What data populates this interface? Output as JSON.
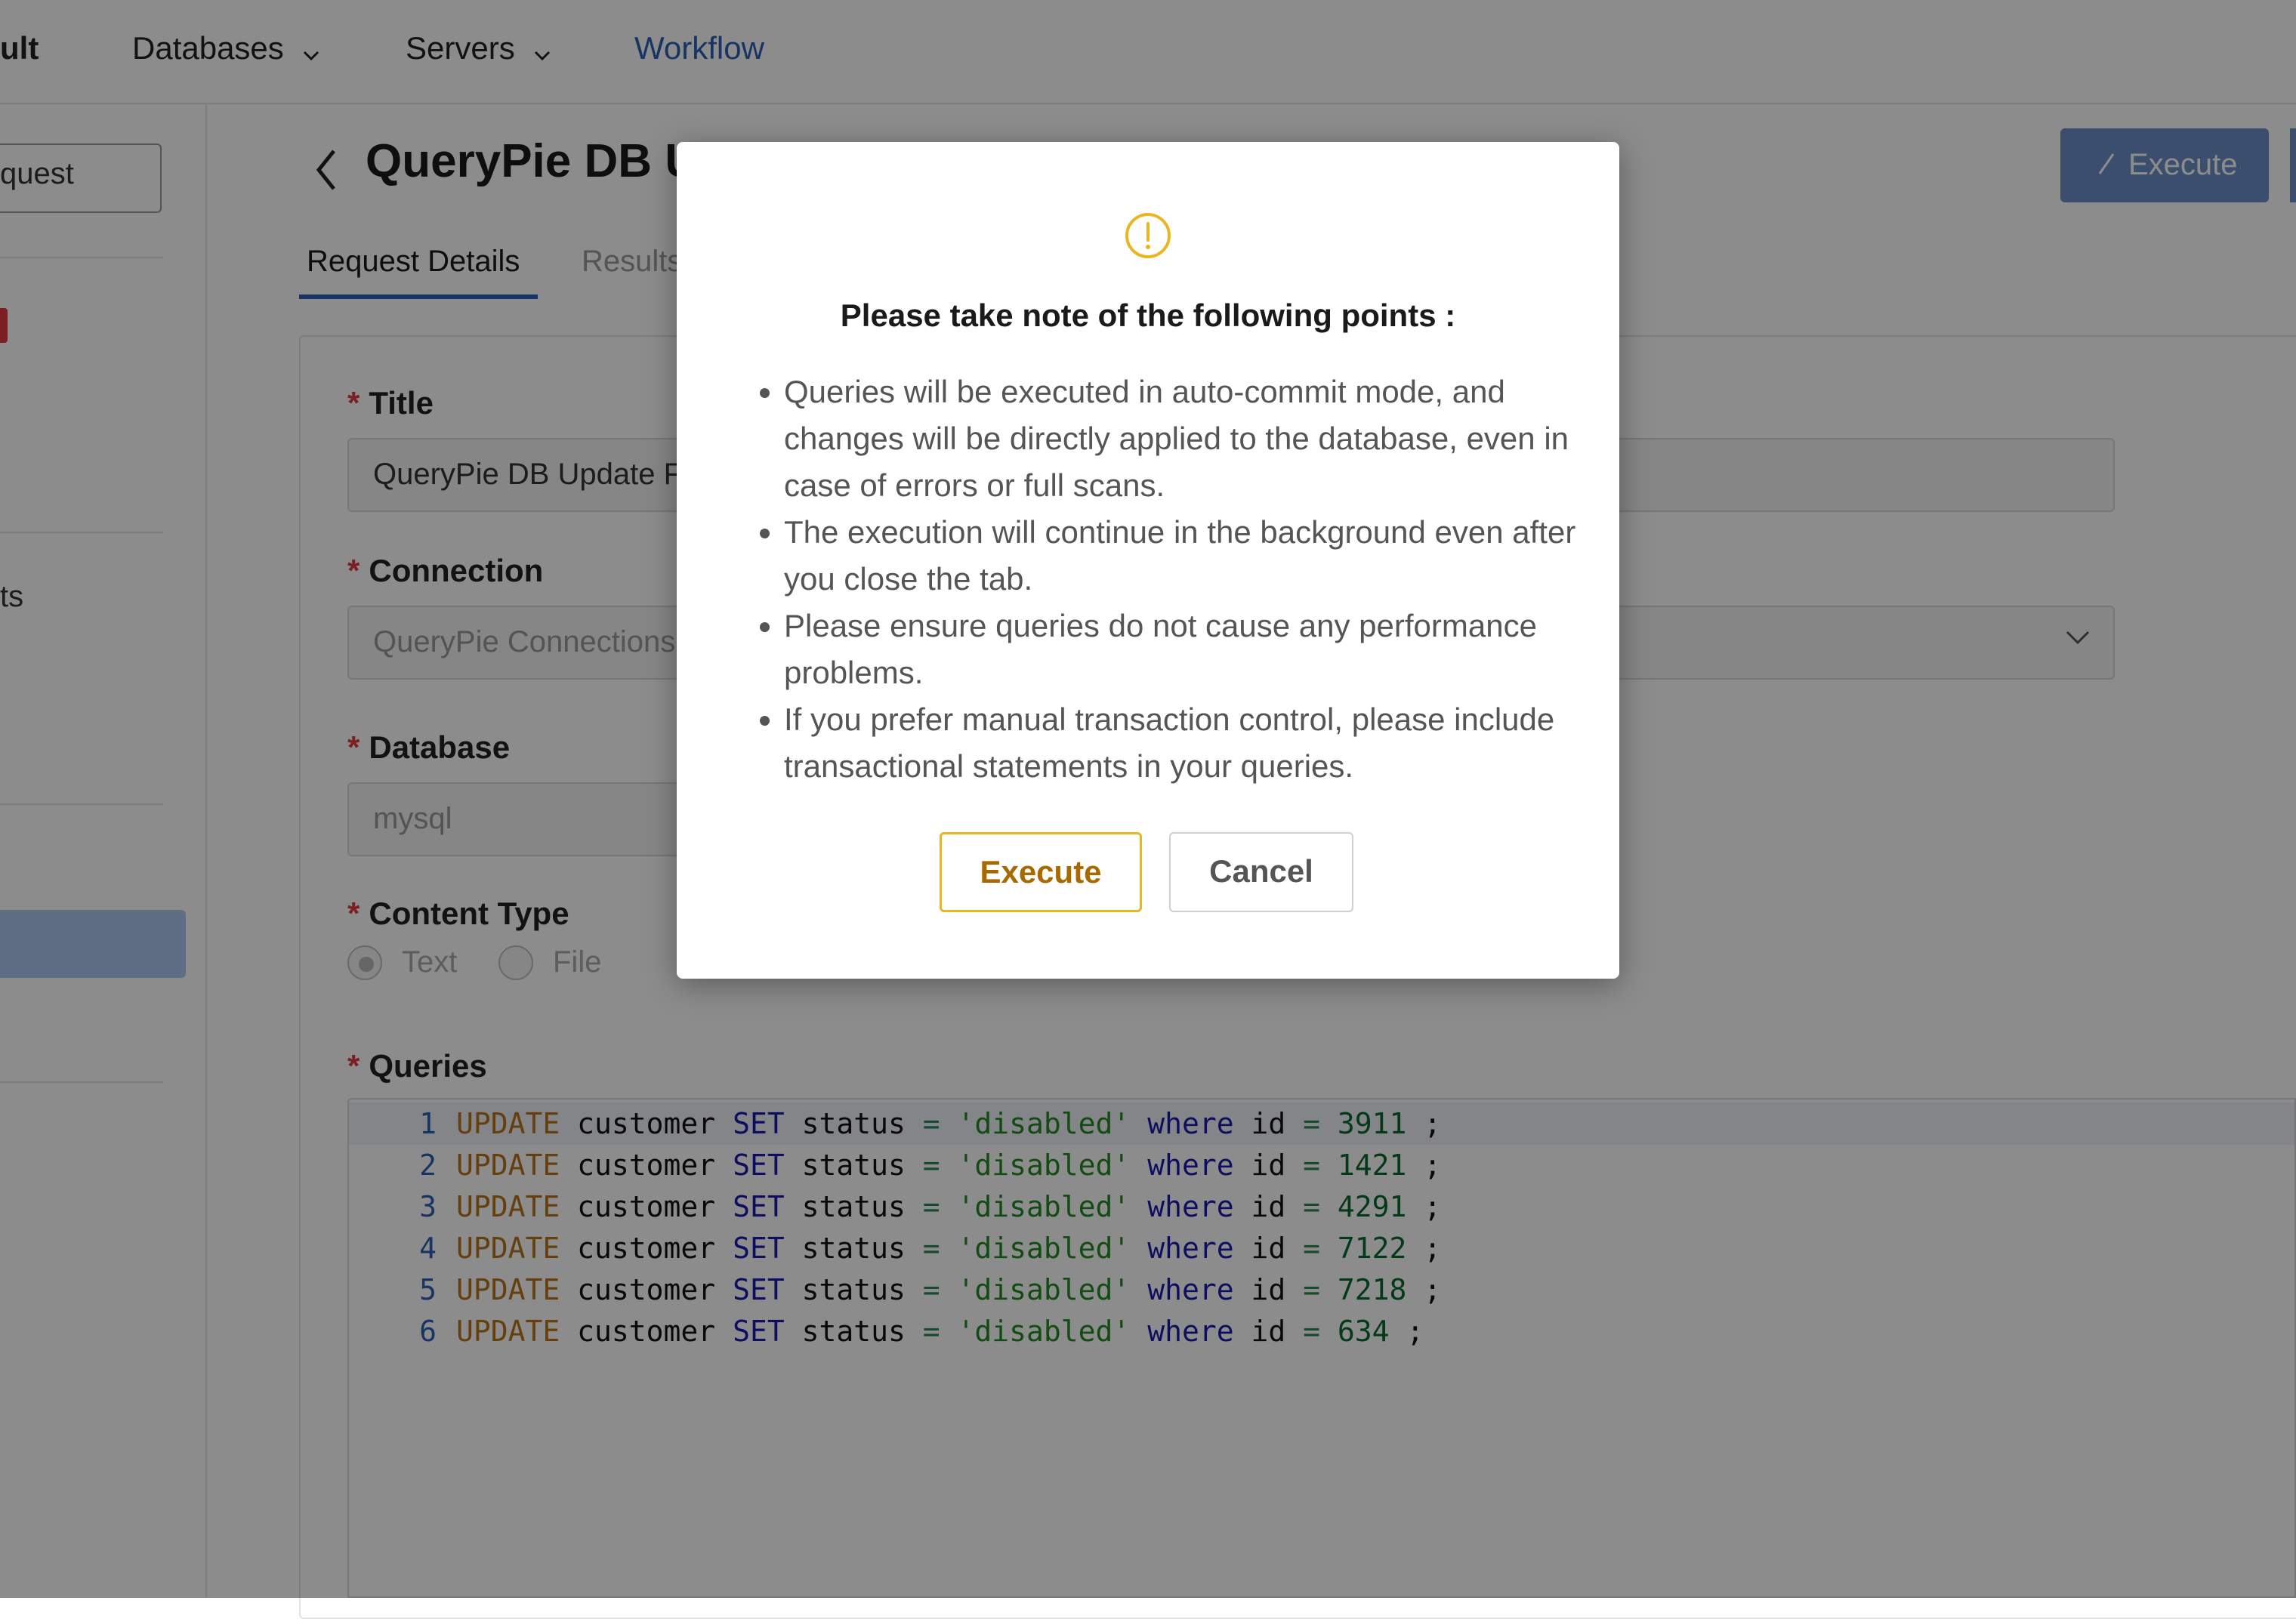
{
  "nav": {
    "brand": "ult",
    "databases": "Databases",
    "servers": "Servers",
    "workflow": "Workflow"
  },
  "sidebar": {
    "request_button": "quest",
    "item_text": "ts"
  },
  "header": {
    "title": "QueryPie DB U",
    "execute_button": "Execute"
  },
  "tabs": [
    {
      "label": "Request Details"
    },
    {
      "label": "Results"
    }
  ],
  "form": {
    "title_label": "Title",
    "title_value": "QueryPie DB Update F",
    "connection_label": "Connection",
    "connection_placeholder": "QueryPie Connections",
    "database_label": "Database",
    "database_placeholder": "mysql",
    "content_type_label": "Content Type",
    "content_type_options": [
      "Text",
      "File"
    ],
    "content_type_selected": "Text",
    "queries_label": "Queries",
    "required_mark": "*"
  },
  "queries": [
    {
      "line": "1",
      "id": "3911"
    },
    {
      "line": "2",
      "id": "1421"
    },
    {
      "line": "3",
      "id": "4291"
    },
    {
      "line": "4",
      "id": "7122"
    },
    {
      "line": "5",
      "id": "7218"
    },
    {
      "line": "6",
      "id": "634"
    }
  ],
  "query_tokens": {
    "update": "UPDATE",
    "table": "customer",
    "set": "SET",
    "column": "status",
    "eq": "=",
    "value": "'disabled'",
    "where": "where",
    "id_col": "id",
    "terminator": ";"
  },
  "modal": {
    "icon": "warning-circle-icon",
    "title": "Please take note of the following points :",
    "points": [
      "Queries will be executed in auto-commit mode, and changes will be directly applied to the database, even in case of errors or full scans.",
      "The execution will continue in the background even after you close the tab.",
      "Please ensure queries do not cause any performance problems.",
      "If you prefer manual transaction control, please include transactional statements in your queries."
    ],
    "execute_label": "Execute",
    "cancel_label": "Cancel"
  },
  "colors": {
    "accent": "#2d5fb8",
    "warning": "#e9b520",
    "required": "#e0393e"
  }
}
